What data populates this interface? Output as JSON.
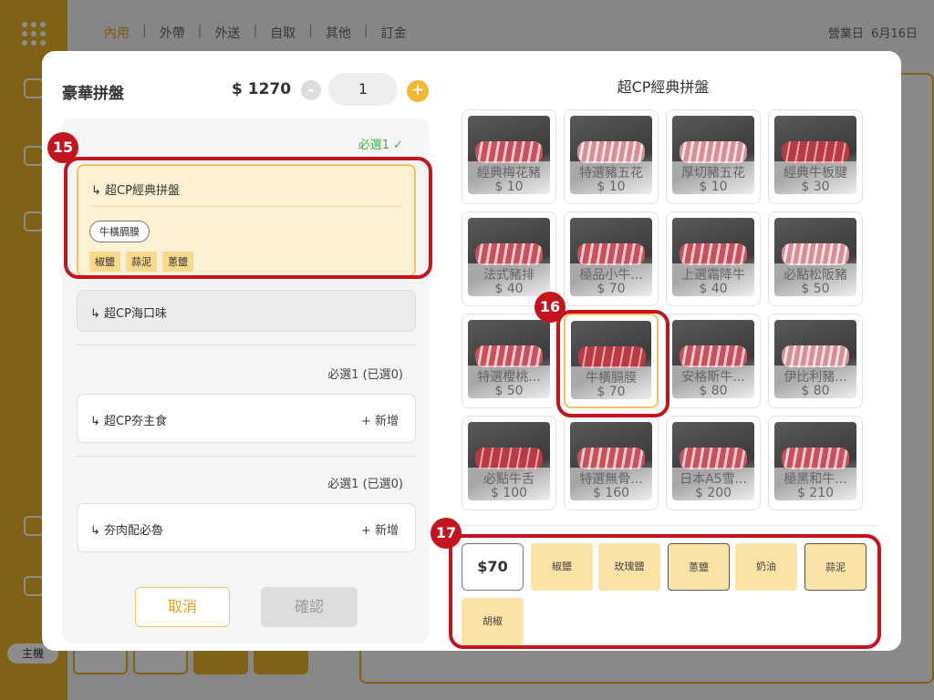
{
  "app": {
    "tabs": [
      "內用",
      "外帶",
      "外送",
      "自取",
      "其他",
      "訂金"
    ],
    "business_date_label": "營業日",
    "business_date": "6月16日",
    "sidebar_host": "主機"
  },
  "modal": {
    "item_name": "豪華拼盤",
    "price": "$ 1270",
    "qty": "1",
    "qty_minus": "-",
    "qty_plus": "+",
    "groups": [
      {
        "requirement": "必選1",
        "options": [
          {
            "title": "↳ 超CP經典拼盤",
            "selected": true,
            "picked": "牛橫膈膜",
            "condiments": [
              "椒鹽",
              "蒜泥",
              "蔥鹽"
            ]
          },
          {
            "title": "↳ 超CP海口味",
            "selected": false
          }
        ]
      },
      {
        "requirement": "必選1 (已選0)",
        "options": [
          {
            "title": "↳ 超CP夯主食",
            "add": "+ 新增"
          }
        ]
      },
      {
        "requirement": "必選1 (已選0)",
        "options": [
          {
            "title": "↳ 夯肉配必魯",
            "add": "+ 新增"
          }
        ]
      }
    ],
    "cancel": "取消",
    "confirm": "確認",
    "right_title": "超CP經典拼盤",
    "products": [
      {
        "name": "經典梅花豬",
        "price": "$ 10",
        "style": "meat"
      },
      {
        "name": "特選豬五花",
        "price": "$ 10",
        "style": "pale"
      },
      {
        "name": "厚切豬五花",
        "price": "$ 10",
        "style": "pale"
      },
      {
        "name": "經典牛板腱",
        "price": "$ 30",
        "style": "lean"
      },
      {
        "name": "法式豬排",
        "price": "$ 40",
        "style": "meat"
      },
      {
        "name": "極品小牛...",
        "price": "$ 70",
        "style": "meat"
      },
      {
        "name": "上選霜降牛",
        "price": "$ 40",
        "style": "meat"
      },
      {
        "name": "必點松阪豬",
        "price": "$ 50",
        "style": "pale"
      },
      {
        "name": "特選櫻桃...",
        "price": "$ 50",
        "style": "meat"
      },
      {
        "name": "牛橫膈膜",
        "price": "$ 70",
        "style": "lean",
        "selected": true
      },
      {
        "name": "安格斯牛...",
        "price": "$ 80",
        "style": "meat"
      },
      {
        "name": "伊比利豬...",
        "price": "$ 80",
        "style": "pale"
      },
      {
        "name": "必點牛舌",
        "price": "$ 100",
        "style": "lean"
      },
      {
        "name": "特選無骨...",
        "price": "$ 160",
        "style": "meat"
      },
      {
        "name": "日本A5雪...",
        "price": "$ 200",
        "style": "meat"
      },
      {
        "name": "極黑和牛...",
        "price": "$ 210",
        "style": "meat"
      }
    ],
    "total_price": "$70",
    "condiments": [
      {
        "label": "椒鹽",
        "outlined": false
      },
      {
        "label": "玫瑰鹽",
        "outlined": false
      },
      {
        "label": "蔥鹽",
        "outlined": true
      },
      {
        "label": "奶油",
        "outlined": false
      },
      {
        "label": "蒜泥",
        "outlined": true
      },
      {
        "label": "胡椒",
        "outlined": false
      }
    ]
  },
  "annotations": [
    "15",
    "16",
    "17"
  ],
  "colors": {
    "accent": "#e9b32a",
    "highlight": "#c4151f",
    "success": "#3fae49"
  }
}
